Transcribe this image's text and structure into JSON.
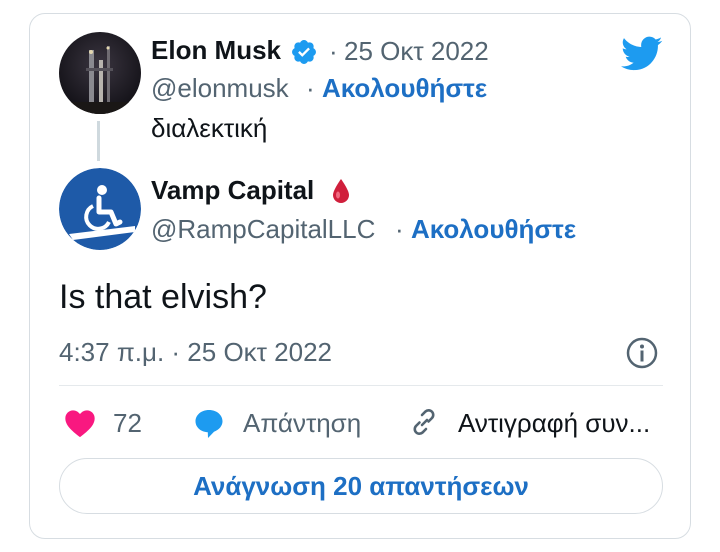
{
  "parent_tweet": {
    "author_name": "Elon Musk",
    "date": "25 Οκτ 2022",
    "handle": "@elonmusk",
    "follow_label": "Ακολουθήστε",
    "text": "διαλεκτική",
    "verified": true
  },
  "reply_tweet": {
    "author_name": "Vamp Capital",
    "handle": "@RampCapitalLLC",
    "follow_label": "Ακολουθήστε",
    "text": "Is that elvish?",
    "timestamp": "4:37 π.μ. · 25 Οκτ 2022"
  },
  "actions": {
    "like_count": "72",
    "reply_label": "Απάντηση",
    "copy_link_label": "Αντιγραφή συν..."
  },
  "read_replies_label": "Ανάγνωση 20 απαντήσεων",
  "separator": "·",
  "colors": {
    "accent": "#1d6fc4",
    "twitter_blue": "#1d9bf0",
    "like_pink": "#f91880",
    "muted": "#536471"
  }
}
